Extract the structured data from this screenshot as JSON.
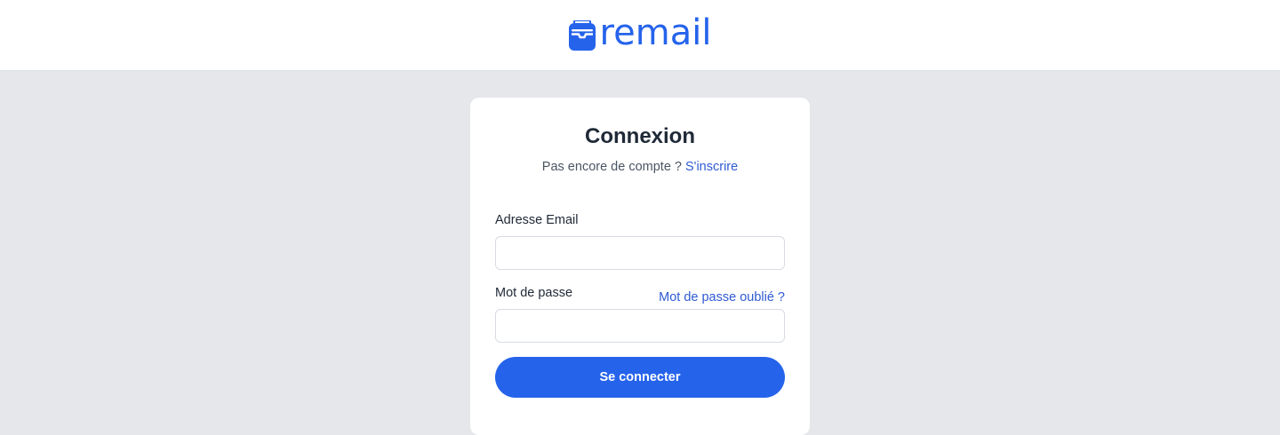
{
  "header": {
    "logo_text": "remail",
    "logo_color": "#2563eb"
  },
  "login": {
    "title": "Connexion",
    "no_account_text": "Pas encore de compte ?",
    "signup_link": "S'inscrire",
    "email_label": "Adresse Email",
    "email_value": "",
    "password_label": "Mot de passe",
    "password_value": "",
    "forgot_link": "Mot de passe oublié ?",
    "submit_label": "Se connecter"
  },
  "colors": {
    "accent": "#2563eb",
    "link": "#2f5bd3",
    "background": "#e5e7eb",
    "heading": "#1f2937"
  },
  "icons": {
    "logo_mark": "mailbox-icon"
  }
}
